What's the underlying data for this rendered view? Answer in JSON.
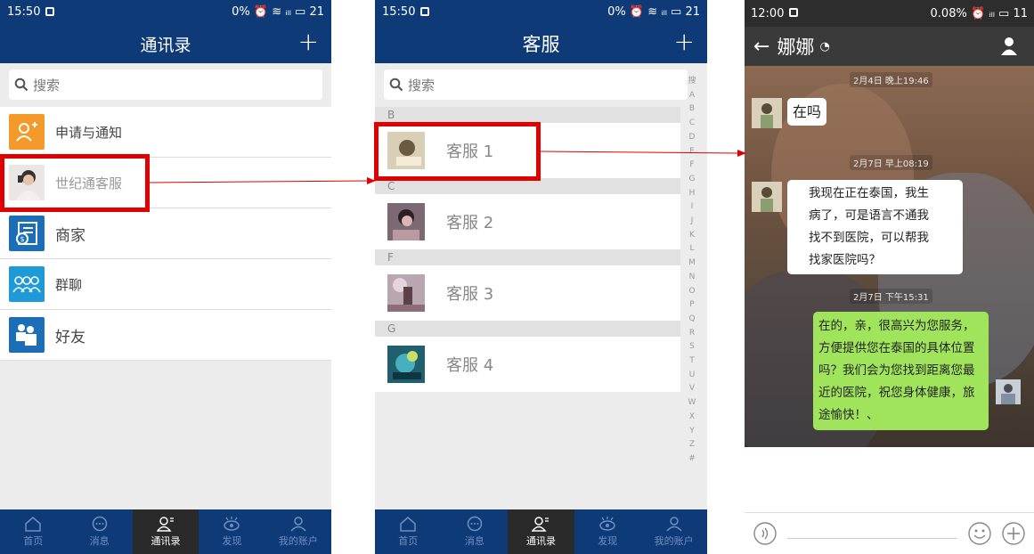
{
  "screen1": {
    "status": {
      "time": "15:50",
      "right": "0% ⏰ ≋ ᵢₗₗ ▭ 21"
    },
    "title": "通讯录",
    "search_placeholder": "搜索",
    "items": [
      {
        "label": "申请与通知",
        "icon": "add-user-icon",
        "color": "#f39a2a"
      },
      {
        "label": "世纪通客服",
        "icon": "avatar-photo",
        "color": "#d8d8d8"
      },
      {
        "label": "商家",
        "icon": "store-icon",
        "color": "#1c6fb6"
      },
      {
        "label": "群聊",
        "icon": "group-icon",
        "color": "#1e9ad8"
      },
      {
        "label": "好友",
        "icon": "friends-icon",
        "color": "#1c6fb6"
      }
    ],
    "tabs": [
      "首页",
      "消息",
      "通讯录",
      "发现",
      "我的账户"
    ],
    "active_tab": "通讯录"
  },
  "screen2": {
    "status": {
      "time": "15:50",
      "right": "0% ⏰ ≋ ᵢₗₗ ▭ 21"
    },
    "title": "客服",
    "search_placeholder": "搜索",
    "groups": [
      {
        "letter": "B",
        "name": "客服 1",
        "color": "#c9b88a"
      },
      {
        "letter": "C",
        "name": "客服 2",
        "color": "#6a5864"
      },
      {
        "letter": "F",
        "name": "客服 3",
        "color": "#9d8e98"
      },
      {
        "letter": "G",
        "name": "客服 4",
        "color": "#2a7c8a"
      }
    ],
    "alphabet": [
      "搜",
      "A",
      "B",
      "C",
      "D",
      "E",
      "F",
      "G",
      "H",
      "I",
      "J",
      "K",
      "L",
      "M",
      "N",
      "O",
      "P",
      "Q",
      "R",
      "S",
      "T",
      "U",
      "V",
      "W",
      "X",
      "Y",
      "Z",
      "#"
    ],
    "tabs": [
      "首页",
      "消息",
      "通讯录",
      "发现",
      "我的账户"
    ],
    "active_tab": "通讯录"
  },
  "screen3": {
    "status": {
      "time": "12:00",
      "right": "0.08% ⏰ ᵢₗₗ ▭ 11"
    },
    "title": "娜娜",
    "messages": [
      {
        "time": "2月4日 晚上19:46",
        "side": "left",
        "text": "在吗"
      },
      {
        "time": "2月7日 早上08:19",
        "side": "left",
        "lines": [
          "我现在正在泰国，我生",
          "病了，可是语言不通我",
          "找不到医院，可以帮我",
          "找家医院吗？"
        ]
      },
      {
        "time": "2月7日 下午15:31",
        "side": "right",
        "lines": [
          "在的，亲，很高兴为您服务，",
          "方便提供您在泰国的具体位置",
          "吗？我们会为您找到距离您最",
          "近的医院，祝您身体健康，旅",
          "途愉快！、"
        ]
      }
    ]
  }
}
